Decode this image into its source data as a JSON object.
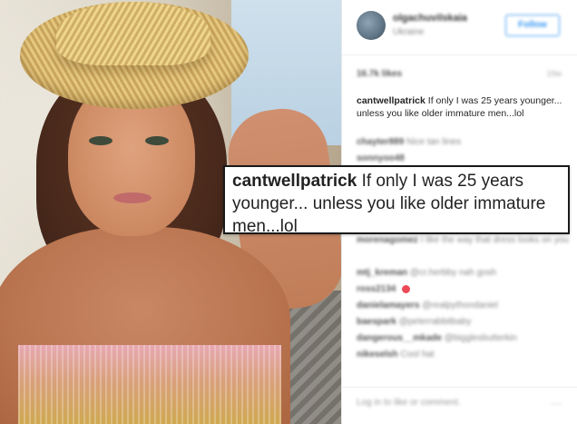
{
  "post": {
    "header": {
      "username": "olgachuvilskaia",
      "location": "Ukraine",
      "follow_label": "Follow"
    },
    "likes": "16.7k likes",
    "time_ago": "19w",
    "caption": {
      "username": "cantwellpatrick",
      "text": "If only I was 25 years younger... unless you like older immature men...lol"
    },
    "comments": [
      {
        "user": "chayter889",
        "text": "Nice tan lines"
      },
      {
        "user": "sonnyoo48",
        "text": ""
      },
      {
        "user": "",
        "text": ""
      },
      {
        "user": "",
        "text": ""
      },
      {
        "user": "",
        "text": ""
      },
      {
        "user": "",
        "text": ""
      },
      {
        "user": "morenagomez",
        "text": "I like the way that dress looks on you"
      },
      {
        "user": "",
        "text": ""
      },
      {
        "user": "mtj_kreman",
        "text": "@cr.herbby nah gosh"
      },
      {
        "user": "ross2134",
        "text": ""
      },
      {
        "user": "danielamayers",
        "text": "@realpythondaniel"
      },
      {
        "user": "baespark",
        "text": "@peterrabbitbaby"
      },
      {
        "user": "dangerous__mkade",
        "text": "@bigglesbutterkin"
      },
      {
        "user": "nikeselsh",
        "text": "Cool hat"
      }
    ],
    "add_comment_placeholder": "Log in to like or comment.",
    "more_glyph": "···"
  },
  "callout": {
    "username": "cantwellpatrick",
    "text": "If only I was 25 years younger... unless you like older immature men...lol"
  },
  "colors": {
    "link_blue": "#3897f0",
    "heart_red": "#ed4956",
    "callout_border": "#1a1a1a"
  }
}
